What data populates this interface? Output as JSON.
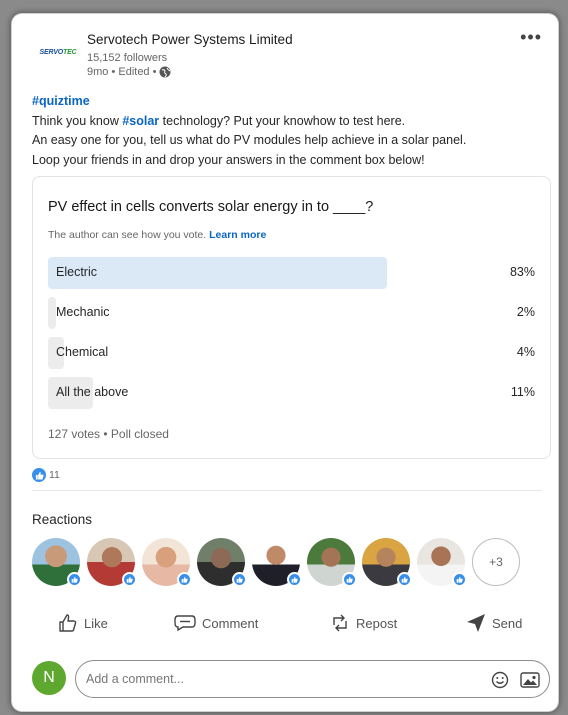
{
  "author": {
    "name": "Servotech Power Systems Limited",
    "followers": "15,152 followers",
    "meta": "9mo • Edited •",
    "logo_text_a": "SERVO",
    "logo_text_b": "TEC"
  },
  "menu": {
    "more_label": "•••"
  },
  "post": {
    "hashtag": "#quiztime",
    "line1_pre": "Think you know ",
    "line1_tag": "#solar",
    "line1_post": " technology? Put your knowhow to test here.",
    "line2": "An easy one for you, tell us what do PV modules help achieve in a solar panel.",
    "line3": "Loop your friends in and drop your answers in the comment box below!"
  },
  "poll": {
    "question": "PV effect in cells converts solar energy in to ____?",
    "note": "The author can see how you vote.",
    "learn_more": "Learn more",
    "options": [
      {
        "label": "Electric",
        "percent_text": "83%",
        "fraction": 0.83
      },
      {
        "label": "Mechanic",
        "percent_text": "2%",
        "fraction": 0.02
      },
      {
        "label": "Chemical",
        "percent_text": "4%",
        "fraction": 0.04
      },
      {
        "label": "All the above",
        "percent_text": "11%",
        "fraction": 0.11
      }
    ],
    "footer": "127 votes • Poll closed"
  },
  "social": {
    "reaction_count": "11"
  },
  "reactions": {
    "title": "Reactions",
    "more_label": "+3",
    "avatars": [
      "avatar-1",
      "avatar-2",
      "avatar-3",
      "avatar-4",
      "avatar-5",
      "avatar-6",
      "avatar-7",
      "avatar-8"
    ]
  },
  "actions": {
    "like": "Like",
    "comment": "Comment",
    "repost": "Repost",
    "send": "Send"
  },
  "comment": {
    "user_initial": "N",
    "placeholder": "Add a comment..."
  },
  "colors": {
    "accent": "#0a66c2",
    "winning_bar": "#dbe9f7",
    "bar": "#ececec",
    "like_blue": "#378fe9",
    "user_avatar": "#5fa82f"
  }
}
